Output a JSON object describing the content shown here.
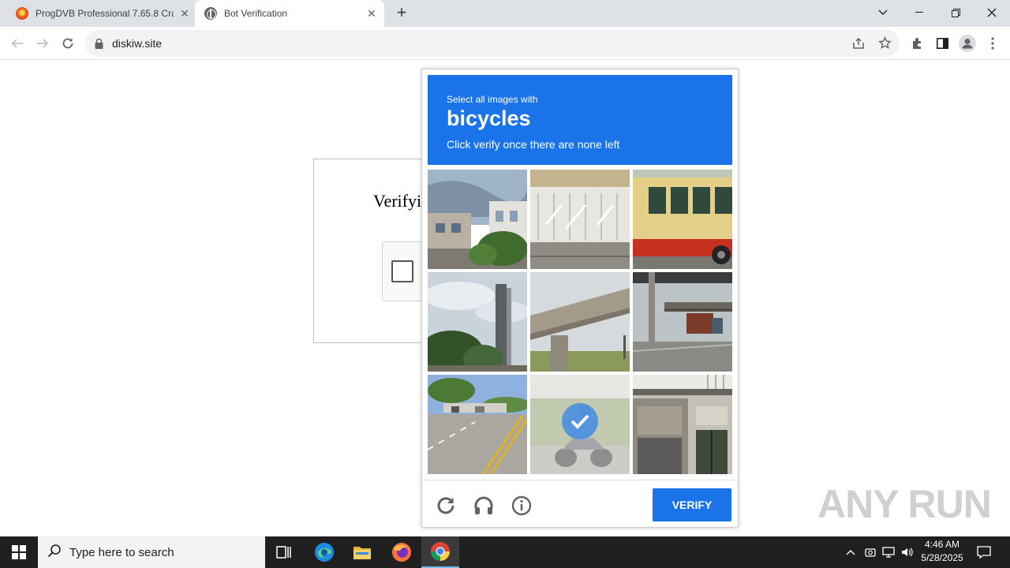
{
  "browser": {
    "tabs": [
      {
        "title": "ProgDVB Professional 7.65.8 Cra",
        "close_glyph": "✕"
      },
      {
        "title": "Bot Verification",
        "close_glyph": "✕"
      }
    ],
    "new_tab_glyph": "+",
    "url": "diskiw.site"
  },
  "page": {
    "verify_text": "Verifyi"
  },
  "captcha": {
    "instruction_small": "Select all images with",
    "target": "bicycles",
    "hint": "Click verify once there are none left",
    "tiles": [
      {
        "scene": "street-houses-tree",
        "selected": false
      },
      {
        "scene": "glass-facade-building",
        "selected": false
      },
      {
        "scene": "yellow-red-bus",
        "selected": false
      },
      {
        "scene": "sky-trees-pillar",
        "selected": false
      },
      {
        "scene": "overpass-bridge",
        "selected": false
      },
      {
        "scene": "truck-under-overpass",
        "selected": false
      },
      {
        "scene": "road-with-trucks",
        "selected": false
      },
      {
        "scene": "motorbike-rider",
        "selected": true
      },
      {
        "scene": "building-storefront",
        "selected": false
      }
    ],
    "verify_label": "VERIFY",
    "accent_color": "#1a73e8"
  },
  "watermark": "ANY RUN",
  "taskbar": {
    "search_placeholder": "Type here to search",
    "time": "4:46 AM",
    "date": "5/28/2025"
  }
}
